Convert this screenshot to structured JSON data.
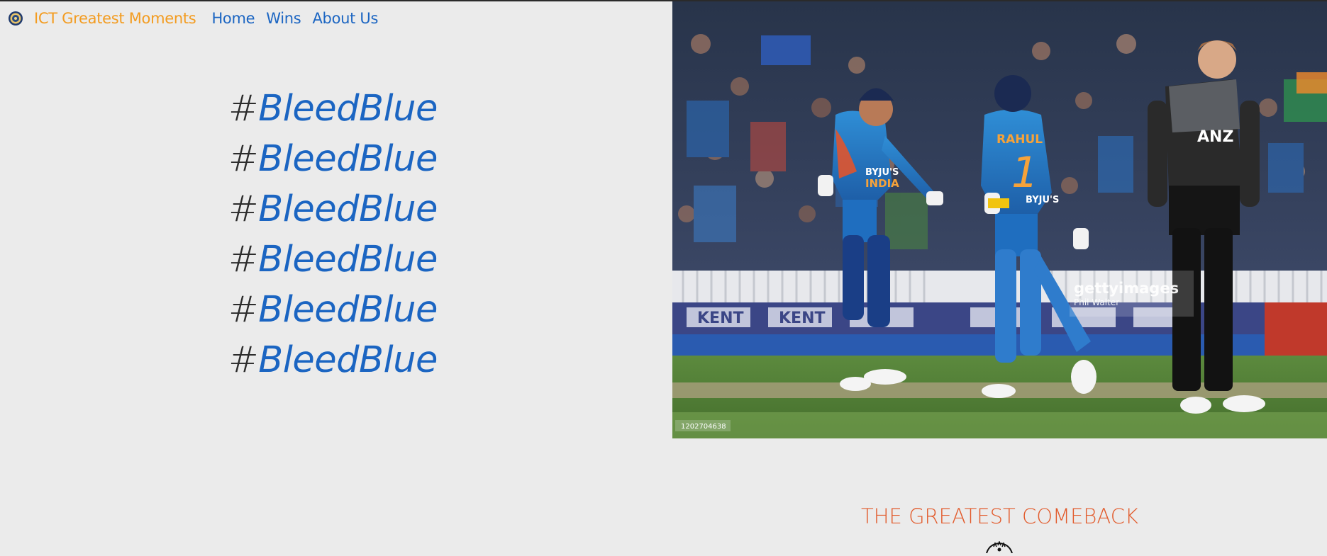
{
  "nav": {
    "logo_icon": "bcci-logo-icon",
    "brand": "ICT Greatest Moments",
    "links": [
      "Home",
      "Wins",
      "About Us"
    ]
  },
  "hero": {
    "hashtags": [
      {
        "hash": "#",
        "part1": "Bleed",
        "part2": "Blue"
      },
      {
        "hash": "#",
        "part1": "Bleed",
        "part2": "Blue"
      },
      {
        "hash": "#",
        "part1": "Bleed",
        "part2": "Blue"
      },
      {
        "hash": "#",
        "part1": "Bleed",
        "part2": "Blue"
      },
      {
        "hash": "#",
        "part1": "Bleed",
        "part2": "Blue"
      },
      {
        "hash": "#",
        "part1": "Bleed",
        "part2": "Blue"
      }
    ]
  },
  "photo": {
    "player1_sponsor": "BYJU'S",
    "player1_team": "INDIA",
    "player2_name": "RAHUL",
    "player2_number": "1",
    "player2_sponsor": "BYJU'S",
    "opponent_sponsor": "ANZ",
    "boundary_board": "KENT",
    "watermark_brand": "gettyimages",
    "watermark_credit": "Phil Walter",
    "image_id": "1202704638"
  },
  "section": {
    "title": "THE GREATEST COMEBACK",
    "icon": "trophy-icon"
  },
  "colors": {
    "brand_orange": "#f39c21",
    "link_blue": "#1b65c2",
    "heading_orange": "#e25b2c",
    "background": "#ebebeb"
  }
}
